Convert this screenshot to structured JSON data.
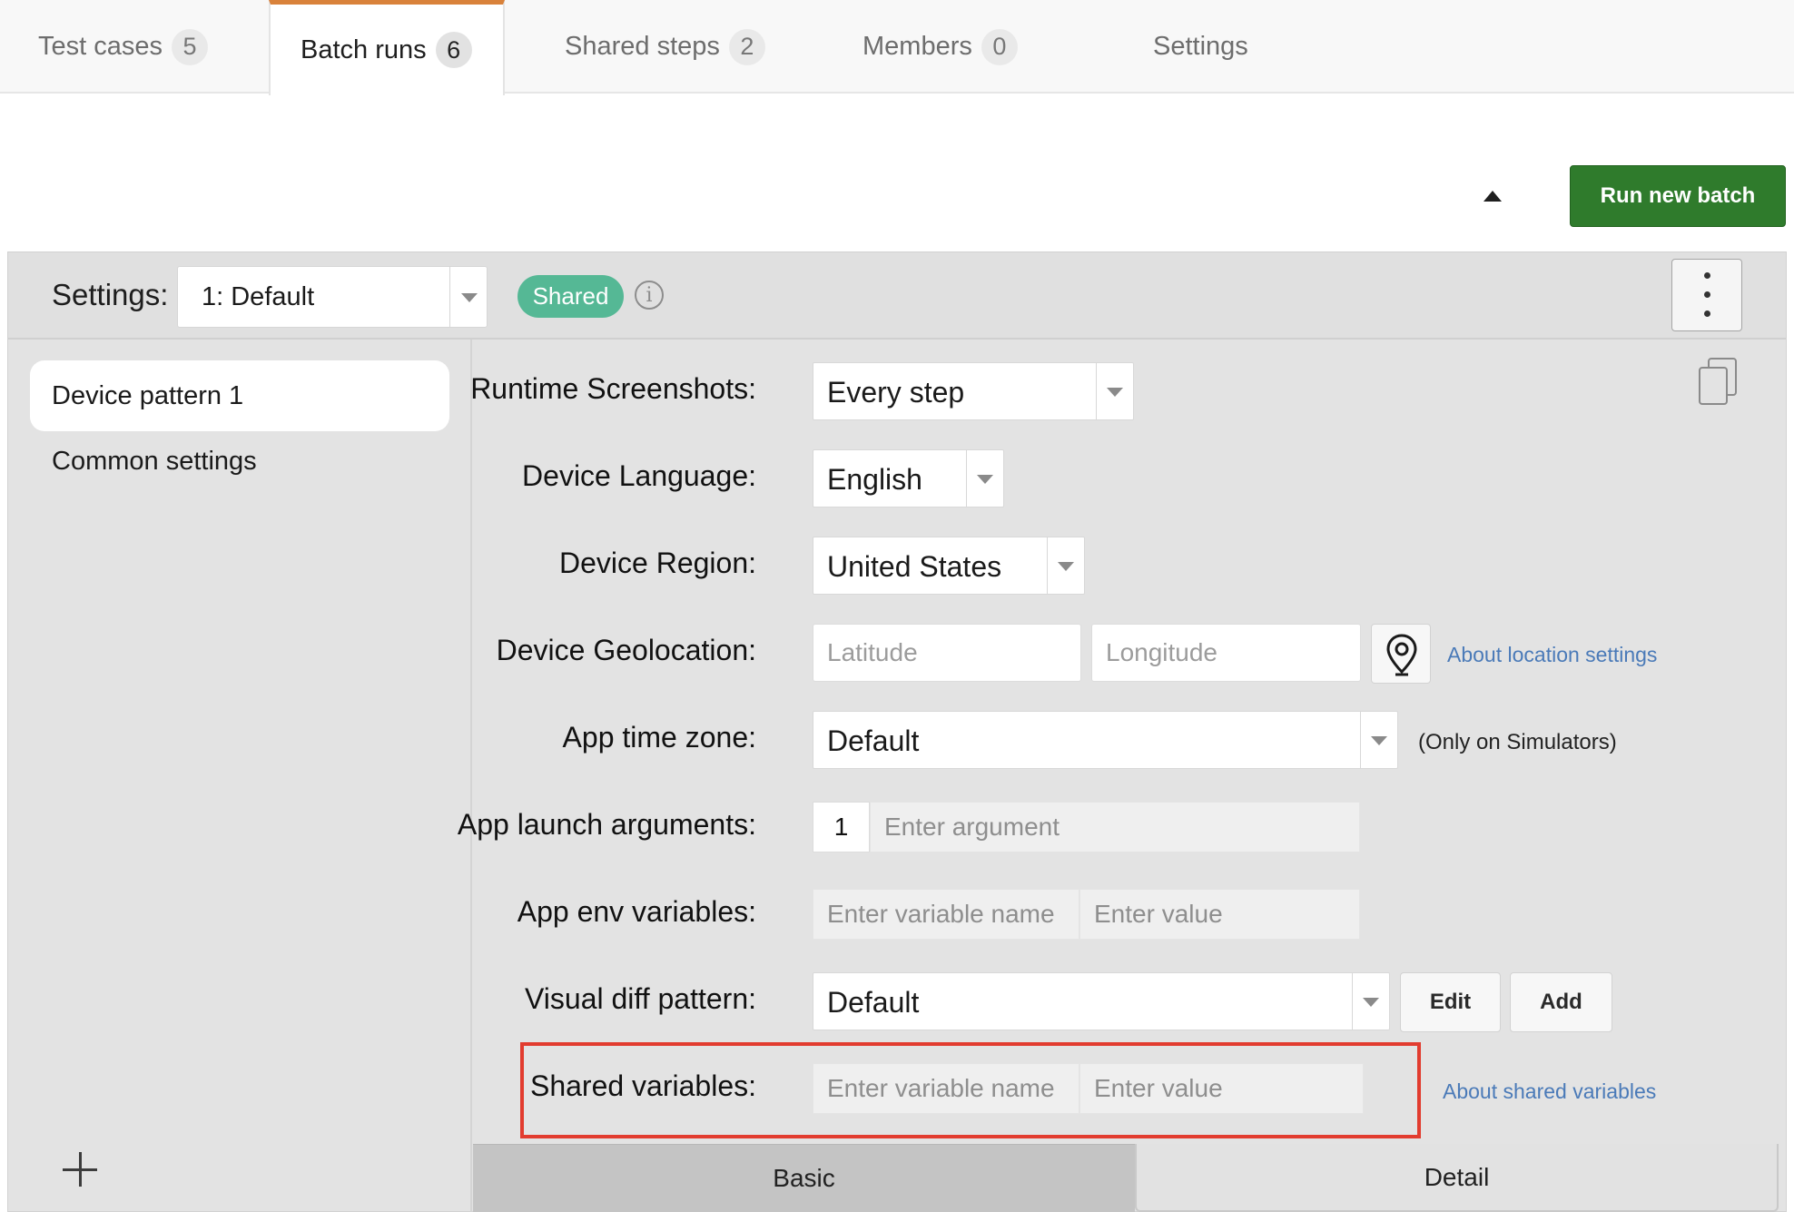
{
  "tabs": [
    {
      "label": "Test cases",
      "count": "5"
    },
    {
      "label": "Batch runs",
      "count": "6"
    },
    {
      "label": "Shared steps",
      "count": "2"
    },
    {
      "label": "Members",
      "count": "0"
    },
    {
      "label": "Settings",
      "count": ""
    }
  ],
  "active_tab": "Batch runs",
  "toolbar": {
    "run_label": "Run new batch",
    "collapse_icon": "caret-up-icon"
  },
  "header": {
    "settings_label": "Settings:",
    "settings_value": "1: Default",
    "shared_badge": "Shared",
    "info_icon": "info-icon",
    "menu_icon": "kebab-menu-icon"
  },
  "sidebar": {
    "items": [
      {
        "label": "Device pattern 1",
        "selected": true
      },
      {
        "label": "Common settings",
        "selected": false
      }
    ],
    "add_icon": "plus-icon"
  },
  "form": {
    "copy_icon": "copy-icon",
    "runtime_screenshots": {
      "label": "Runtime Screenshots:",
      "value": "Every step"
    },
    "device_language": {
      "label": "Device Language:",
      "value": "English"
    },
    "device_region": {
      "label": "Device Region:",
      "value": "United States"
    },
    "device_geolocation": {
      "label": "Device Geolocation:",
      "latitude_placeholder": "Latitude",
      "longitude_placeholder": "Longitude",
      "pin_icon": "map-pin-icon",
      "help_link": "About location settings"
    },
    "app_time_zone": {
      "label": "App time zone:",
      "value": "Default",
      "note": "(Only on Simulators)"
    },
    "app_launch_arguments": {
      "label": "App launch arguments:",
      "index": "1",
      "placeholder": "Enter argument"
    },
    "app_env_variables": {
      "label": "App env variables:",
      "name_placeholder": "Enter variable name",
      "value_placeholder": "Enter value"
    },
    "visual_diff_pattern": {
      "label": "Visual diff pattern:",
      "value": "Default",
      "edit_label": "Edit",
      "add_label": "Add"
    },
    "shared_variables": {
      "label": "Shared variables:",
      "name_placeholder": "Enter variable name",
      "value_placeholder": "Enter value",
      "help_link": "About shared variables"
    }
  },
  "bottom_tabs": [
    {
      "label": "Basic",
      "active": true
    },
    {
      "label": "Detail",
      "active": false
    }
  ],
  "colors": {
    "accent_tab": "#d9823b",
    "run_button": "#2f7b2c",
    "shared_badge": "#55b895",
    "link": "#4a7ab8",
    "highlight": "#e23c2f"
  }
}
